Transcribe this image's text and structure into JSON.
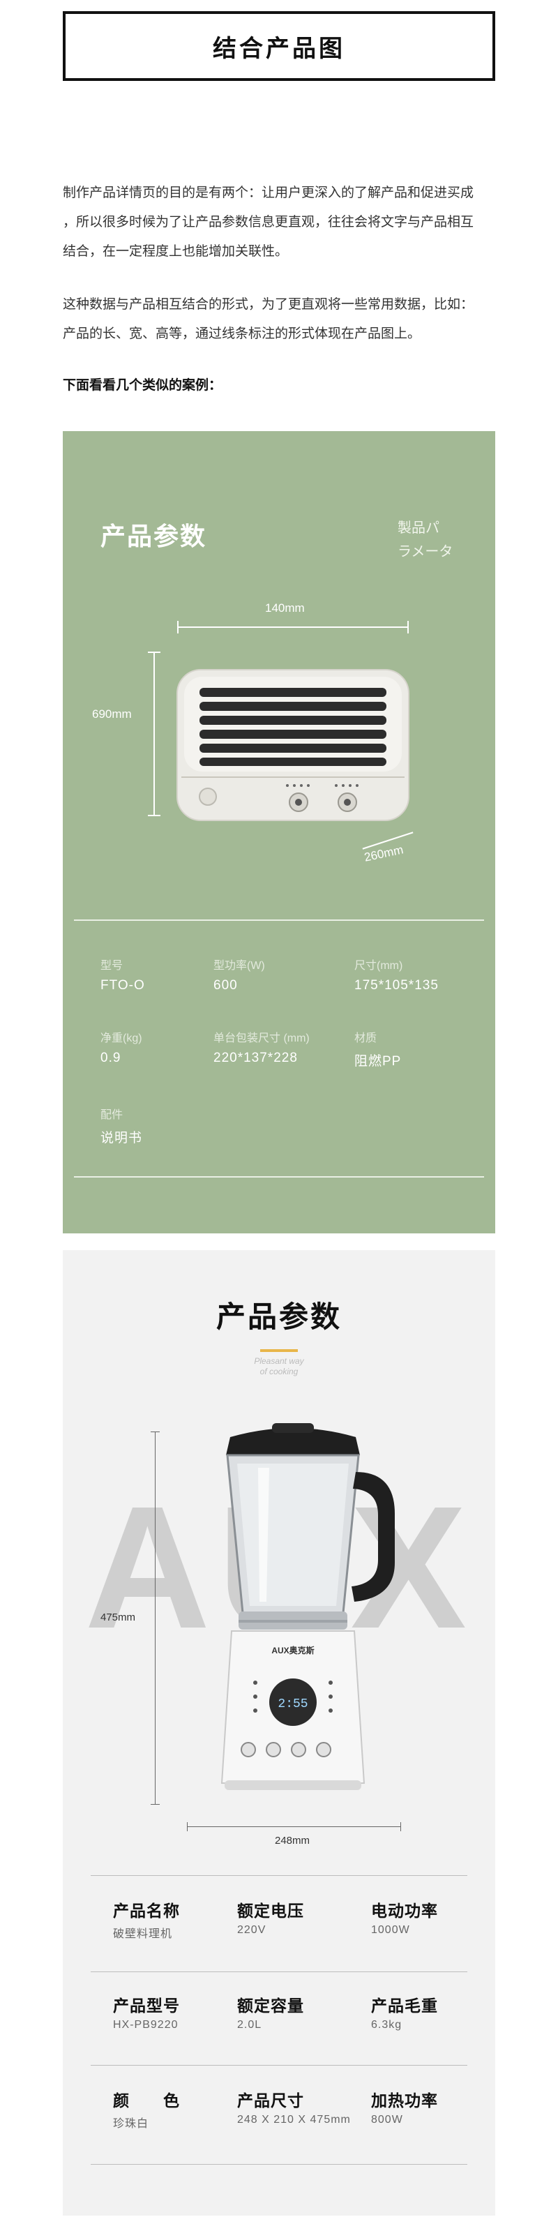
{
  "header": {
    "title": "结合产品图"
  },
  "intro": {
    "para1_line1": "制作产品详情页的目的是有两个：让用户更深入的了解产品和促进买成",
    "para1_line2": "，所以很多时候为了让产品参数信息更直观，往往会将文字与产品相互",
    "para1_line3": "结合，在一定程度上也能增加关联性。",
    "para2_line1": "这种数据与产品相互结合的形式，为了更直观将一些常用数据，比如：",
    "para2_line2": "产品的长、宽、高等，通过线条标注的形式体现在产品图上。",
    "cases_heading": "下面看看几个类似的案例："
  },
  "case1": {
    "title": "产品参数",
    "subtitle_line1": "製品パ",
    "subtitle_line2": "ラメータ",
    "dimensions": {
      "width": "140mm",
      "height": "690mm",
      "depth": "260mm"
    },
    "specs": [
      {
        "label": "型号",
        "value": "FTO-O"
      },
      {
        "label": "型功率(W)",
        "value": "600"
      },
      {
        "label": "尺寸(mm)",
        "value": "175*105*135"
      },
      {
        "label": "净重(kg)",
        "value": "0.9"
      },
      {
        "label": "单台包装尺寸 (mm)",
        "value": "220*137*228"
      },
      {
        "label": "材质",
        "value": "阻燃PP"
      },
      {
        "label": "配件",
        "value": "说明书"
      }
    ],
    "colors": {
      "panel": "#a3b995",
      "heater_body": "#ecebe6"
    }
  },
  "case2": {
    "title": "产品参数",
    "tagline_line1": "Pleasant way",
    "tagline_line2": "of cooking",
    "watermark": "AUX",
    "brand": "AUX奥克斯",
    "display": "2:55",
    "dimensions": {
      "height": "475mm",
      "width": "248mm"
    },
    "specs": [
      {
        "label": "产品名称",
        "value": "破壁料理机"
      },
      {
        "label": "额定电压",
        "value": "220V"
      },
      {
        "label": "电动功率",
        "value": "1000W"
      },
      {
        "label": "产品型号",
        "value": "HX-PB9220"
      },
      {
        "label": "额定容量",
        "value": "2.0L"
      },
      {
        "label": "产品毛重",
        "value": "6.3kg"
      },
      {
        "label": "颜　　色",
        "value": "珍珠白"
      },
      {
        "label": "产品尺寸",
        "value": "248 X 210 X 475mm"
      },
      {
        "label": "加热功率",
        "value": "800W"
      }
    ],
    "colors": {
      "panel": "#f2f2f2",
      "accent": "#e8b64a"
    }
  }
}
